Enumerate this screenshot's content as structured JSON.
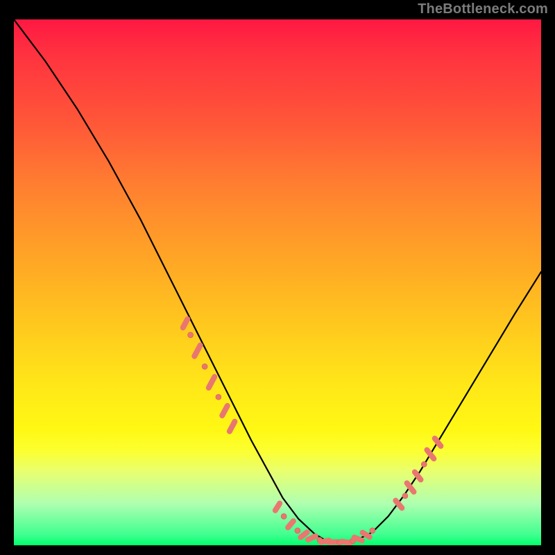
{
  "watermark": "TheBottleneck.com",
  "colors": {
    "marker_fill": "#e9776f",
    "marker_stroke": "#d45a54",
    "curve_stroke": "#000000"
  },
  "chart_data": {
    "type": "line",
    "title": "",
    "xlabel": "",
    "ylabel": "",
    "xlim": [
      0,
      100
    ],
    "ylim": [
      0,
      100
    ],
    "grid": false,
    "legend": false,
    "series": [
      {
        "name": "bottleneck-curve",
        "x": [
          0,
          3,
          6,
          9,
          12,
          15,
          18,
          21,
          24,
          27,
          30,
          33,
          36,
          39,
          42,
          45,
          48,
          51,
          54,
          57,
          59,
          61,
          63,
          65,
          68,
          71,
          74,
          77,
          80,
          83,
          86,
          89,
          92,
          95,
          100
        ],
        "y": [
          100,
          96,
          92,
          87.5,
          83,
          78,
          73,
          67.5,
          62,
          56,
          50,
          44,
          38,
          32,
          26,
          20,
          14.5,
          9,
          5,
          2.2,
          1.0,
          0.5,
          0.5,
          1.0,
          2.5,
          5.5,
          9.5,
          14,
          19,
          24,
          29,
          34,
          39,
          44,
          52
        ]
      }
    ],
    "markers": [
      {
        "kind": "dash",
        "x": 32.5,
        "y": 42.2,
        "angle": 62,
        "len": 14
      },
      {
        "kind": "dot",
        "x": 33.5,
        "y": 40.0
      },
      {
        "kind": "dash",
        "x": 34.8,
        "y": 37.0,
        "angle": 62,
        "len": 18
      },
      {
        "kind": "dot",
        "x": 36.2,
        "y": 34.0
      },
      {
        "kind": "dash",
        "x": 37.5,
        "y": 31.0,
        "angle": 62,
        "len": 18
      },
      {
        "kind": "dot",
        "x": 38.8,
        "y": 28.2
      },
      {
        "kind": "dash",
        "x": 40.0,
        "y": 25.6,
        "angle": 62,
        "len": 16
      },
      {
        "kind": "dash",
        "x": 41.4,
        "y": 22.6,
        "angle": 62,
        "len": 16
      },
      {
        "kind": "dash",
        "x": 50.0,
        "y": 7.3,
        "angle": 58,
        "len": 12
      },
      {
        "kind": "dot",
        "x": 51.2,
        "y": 5.5
      },
      {
        "kind": "dash",
        "x": 52.5,
        "y": 4.0,
        "angle": 50,
        "len": 12
      },
      {
        "kind": "dot",
        "x": 53.8,
        "y": 2.8
      },
      {
        "kind": "dash",
        "x": 55.0,
        "y": 2.0,
        "angle": 38,
        "len": 12
      },
      {
        "kind": "dash",
        "x": 56.5,
        "y": 1.4,
        "angle": 26,
        "len": 12
      },
      {
        "kind": "dot",
        "x": 58.0,
        "y": 1.0
      },
      {
        "kind": "dash",
        "x": 59.0,
        "y": 0.75,
        "angle": 12,
        "len": 12
      },
      {
        "kind": "dash",
        "x": 60.5,
        "y": 0.6,
        "angle": 2,
        "len": 12
      },
      {
        "kind": "dot",
        "x": 61.8,
        "y": 0.55
      },
      {
        "kind": "dash",
        "x": 63.0,
        "y": 0.6,
        "angle": -8,
        "len": 12
      },
      {
        "kind": "dot",
        "x": 64.3,
        "y": 0.85
      },
      {
        "kind": "dash",
        "x": 65.3,
        "y": 1.2,
        "angle": -22,
        "len": 12
      },
      {
        "kind": "dash",
        "x": 66.8,
        "y": 2.0,
        "angle": -32,
        "len": 12
      },
      {
        "kind": "dot",
        "x": 68.0,
        "y": 2.8
      },
      {
        "kind": "dash",
        "x": 73.0,
        "y": 7.8,
        "angle": -50,
        "len": 14
      },
      {
        "kind": "dot",
        "x": 74.2,
        "y": 9.4
      },
      {
        "kind": "dash",
        "x": 75.2,
        "y": 11.0,
        "angle": -52,
        "len": 16
      },
      {
        "kind": "dash",
        "x": 76.6,
        "y": 13.2,
        "angle": -52,
        "len": 14
      },
      {
        "kind": "dot",
        "x": 77.8,
        "y": 15.4
      },
      {
        "kind": "dash",
        "x": 79.0,
        "y": 17.3,
        "angle": -52,
        "len": 16
      },
      {
        "kind": "dash",
        "x": 80.4,
        "y": 19.6,
        "angle": -52,
        "len": 14
      }
    ]
  }
}
